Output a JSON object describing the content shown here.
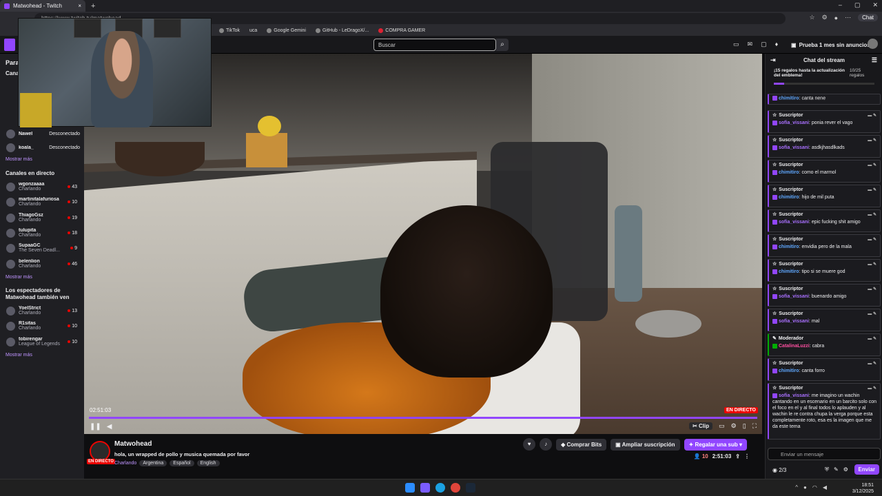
{
  "browser": {
    "tab_title": "Matwohead - Twitch",
    "address": "https://www.twitch.tv/matwohead",
    "chat_button": "Chat",
    "bookmarks": [
      "TikTok",
      "uca",
      "Google Gemini",
      "GitHub - LeDragoX/...",
      "COMPRA GAMER"
    ]
  },
  "topnav": {
    "search_placeholder": "Buscar",
    "prime_label": "Prueba 1 mes sin anuncios"
  },
  "sidebar": {
    "heading_followed": "Para",
    "heading_channels": "Canal",
    "offline": [
      {
        "name": "Nawel",
        "status": "Desconectado"
      },
      {
        "name": "koala_",
        "status": "Desconectado"
      }
    ],
    "show_more": "Mostrar más",
    "live_heading": "Canales en directo",
    "live": [
      {
        "name": "wgonzaaaa",
        "category": "Charlando",
        "viewers": "43"
      },
      {
        "name": "martinitalafuriosa",
        "category": "Charlando",
        "viewers": "10"
      },
      {
        "name": "ThiagoGsz",
        "category": "Charlando",
        "viewers": "19"
      },
      {
        "name": "tulupita",
        "category": "Charlando",
        "viewers": "18"
      },
      {
        "name": "SupaaGC",
        "category": "The Seven Deadl...",
        "viewers": "9"
      },
      {
        "name": "belenlion",
        "category": "Charlando",
        "viewers": "46"
      }
    ],
    "also_heading": "Los espectadores de Matwohead también ven",
    "also": [
      {
        "name": "YoelStrict",
        "category": "Charlando",
        "viewers": "13"
      },
      {
        "name": "R1sitas",
        "category": "Charlando",
        "viewers": "10"
      },
      {
        "name": "tobirengar",
        "category": "League of Legends",
        "viewers": "10"
      }
    ]
  },
  "player": {
    "elapsed": "02:51:03",
    "live_badge": "EN DIRECTO",
    "clip_label": "Clip"
  },
  "stream": {
    "channel": "Matwohead",
    "title": "hola, un wrapped de pollo y musica quemada por favor",
    "live_badge": "EN DIRECTO",
    "category": "Charlando",
    "tags": [
      "Argentina",
      "Español",
      "English"
    ],
    "bits_label": "Comprar Bits",
    "sub_label": "Ampliar suscripción",
    "gift_label": "Regalar una sub",
    "viewers": "10",
    "uptime": "2:51:03"
  },
  "chat": {
    "title": "Chat del stream",
    "gift_banner": "¡15 regalos hasta la actualización del emblema!",
    "gift_progress": "10/25 regalos",
    "top_message": {
      "user": "chimitiro",
      "text": ": canta nene"
    },
    "messages": [
      {
        "role": "Suscriptor",
        "user": "sofia_vissani",
        "color": "#a970ff",
        "text": ": ponia rever el vago"
      },
      {
        "role": "Suscriptor",
        "user": "sofia_vissani",
        "color": "#a970ff",
        "text": ": asdkjhasdlkads"
      },
      {
        "role": "Suscriptor",
        "user": "chimitiro",
        "color": "#5fa8ff",
        "text": ": como el marmol"
      },
      {
        "role": "Suscriptor",
        "user": "chimitiro",
        "color": "#5fa8ff",
        "text": ": hijo de mil puta"
      },
      {
        "role": "Suscriptor",
        "user": "sofia_vissani",
        "color": "#a970ff",
        "text": ": epic fucking shit amigo"
      },
      {
        "role": "Suscriptor",
        "user": "chimitiro",
        "color": "#5fa8ff",
        "text": ": envidia pero de la mala"
      },
      {
        "role": "Suscriptor",
        "user": "chimitiro",
        "color": "#5fa8ff",
        "text": ": tipo si se muere god"
      },
      {
        "role": "Suscriptor",
        "user": "sofia_vissani",
        "color": "#a970ff",
        "text": ": buenardo amigo"
      },
      {
        "role": "Suscriptor",
        "user": "sofia_vissani",
        "color": "#a970ff",
        "text": ": mal"
      },
      {
        "role": "Moderador",
        "user": "CatalinaLuzzi",
        "color": "#ff4fa0",
        "text": ": cabra"
      },
      {
        "role": "Suscriptor",
        "user": "chimitiro",
        "color": "#5fa8ff",
        "text": ": canta forro"
      },
      {
        "role": "Suscriptor",
        "user": "sofia_vissani",
        "color": "#a970ff",
        "text": ": me imagino un wachin cantando en un escenario en un barcito solo con el foco en el y al final todos lo aplauden y al wachin le re contra chupa la verga porque esta completamente roto, esa es la imagen que me da este tema"
      }
    ],
    "input_placeholder": "Enviar un mensaje",
    "points": "2/3",
    "send_label": "Enviar"
  },
  "taskbar": {
    "time": "18:51",
    "date": "3/12/2025"
  }
}
